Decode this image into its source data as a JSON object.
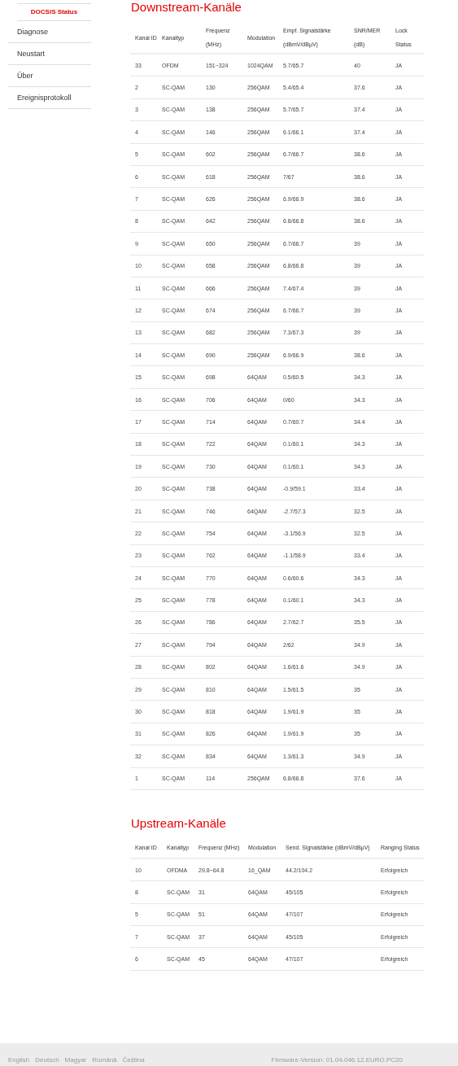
{
  "sidebar": {
    "items": [
      {
        "label": "DOCSIS Status",
        "selected": true
      },
      {
        "label": "Diagnose",
        "selected": false
      },
      {
        "label": "Neustart",
        "selected": false
      },
      {
        "label": "Über",
        "selected": false
      },
      {
        "label": "Ereignisprotokoll",
        "selected": false
      }
    ]
  },
  "downstream": {
    "title": "Downstream-Kanäle",
    "columns": [
      "Kanal ID",
      "Kanaltyp",
      "Frequenz (MHz)",
      "Modulation",
      "Empf. Signalstärke (dBmV/dBµV)",
      "SNR/MER (dB)",
      "Lock Status"
    ],
    "rows": [
      [
        "33",
        "OFDM",
        "151~324",
        "1024QAM",
        "5.7/65.7",
        "40",
        "JA"
      ],
      [
        "2",
        "SC-QAM",
        "130",
        "256QAM",
        "5.4/65.4",
        "37.6",
        "JA"
      ],
      [
        "3",
        "SC-QAM",
        "138",
        "256QAM",
        "5.7/65.7",
        "37.4",
        "JA"
      ],
      [
        "4",
        "SC-QAM",
        "146",
        "256QAM",
        "6.1/66.1",
        "37.4",
        "JA"
      ],
      [
        "5",
        "SC-QAM",
        "602",
        "256QAM",
        "6.7/66.7",
        "38.6",
        "JA"
      ],
      [
        "6",
        "SC-QAM",
        "618",
        "256QAM",
        "7/67",
        "38.6",
        "JA"
      ],
      [
        "7",
        "SC-QAM",
        "626",
        "256QAM",
        "6.9/66.9",
        "38.6",
        "JA"
      ],
      [
        "8",
        "SC-QAM",
        "642",
        "256QAM",
        "6.8/66.8",
        "38.6",
        "JA"
      ],
      [
        "9",
        "SC-QAM",
        "650",
        "256QAM",
        "6.7/66.7",
        "39",
        "JA"
      ],
      [
        "10",
        "SC-QAM",
        "658",
        "256QAM",
        "6.8/66.8",
        "39",
        "JA"
      ],
      [
        "11",
        "SC-QAM",
        "666",
        "256QAM",
        "7.4/67.4",
        "39",
        "JA"
      ],
      [
        "12",
        "SC-QAM",
        "674",
        "256QAM",
        "6.7/66.7",
        "39",
        "JA"
      ],
      [
        "13",
        "SC-QAM",
        "682",
        "256QAM",
        "7.3/67.3",
        "39",
        "JA"
      ],
      [
        "14",
        "SC-QAM",
        "690",
        "256QAM",
        "6.9/66.9",
        "38.6",
        "JA"
      ],
      [
        "15",
        "SC-QAM",
        "698",
        "64QAM",
        "0.5/60.5",
        "34.3",
        "JA"
      ],
      [
        "16",
        "SC-QAM",
        "706",
        "64QAM",
        "0/60",
        "34.3",
        "JA"
      ],
      [
        "17",
        "SC-QAM",
        "714",
        "64QAM",
        "0.7/60.7",
        "34.4",
        "JA"
      ],
      [
        "18",
        "SC-QAM",
        "722",
        "64QAM",
        "0.1/60.1",
        "34.3",
        "JA"
      ],
      [
        "19",
        "SC-QAM",
        "730",
        "64QAM",
        "0.1/60.1",
        "34.3",
        "JA"
      ],
      [
        "20",
        "SC-QAM",
        "738",
        "64QAM",
        "-0.9/59.1",
        "33.4",
        "JA"
      ],
      [
        "21",
        "SC-QAM",
        "746",
        "64QAM",
        "-2.7/57.3",
        "32.5",
        "JA"
      ],
      [
        "22",
        "SC-QAM",
        "754",
        "64QAM",
        "-3.1/56.9",
        "32.5",
        "JA"
      ],
      [
        "23",
        "SC-QAM",
        "762",
        "64QAM",
        "-1.1/58.9",
        "33.4",
        "JA"
      ],
      [
        "24",
        "SC-QAM",
        "770",
        "64QAM",
        "0.6/60.6",
        "34.3",
        "JA"
      ],
      [
        "25",
        "SC-QAM",
        "778",
        "64QAM",
        "0.1/60.1",
        "34.3",
        "JA"
      ],
      [
        "26",
        "SC-QAM",
        "786",
        "64QAM",
        "2.7/62.7",
        "35.5",
        "JA"
      ],
      [
        "27",
        "SC-QAM",
        "794",
        "64QAM",
        "2/62",
        "34.9",
        "JA"
      ],
      [
        "28",
        "SC-QAM",
        "802",
        "64QAM",
        "1.6/61.6",
        "34.9",
        "JA"
      ],
      [
        "29",
        "SC-QAM",
        "810",
        "64QAM",
        "1.5/61.5",
        "35",
        "JA"
      ],
      [
        "30",
        "SC-QAM",
        "818",
        "64QAM",
        "1.9/61.9",
        "35",
        "JA"
      ],
      [
        "31",
        "SC-QAM",
        "826",
        "64QAM",
        "1.9/61.9",
        "35",
        "JA"
      ],
      [
        "32",
        "SC-QAM",
        "834",
        "64QAM",
        "1.3/61.3",
        "34.9",
        "JA"
      ],
      [
        "1",
        "SC-QAM",
        "114",
        "256QAM",
        "6.8/66.8",
        "37.6",
        "JA"
      ]
    ]
  },
  "upstream": {
    "title": "Upstream-Kanäle",
    "columns": [
      "Kanal ID",
      "Kanaltyp",
      "Frequenz (MHz)",
      "Modulation",
      "Send. Signalstärke (dBmV/dBµV)",
      "Ranging Status"
    ],
    "rows": [
      [
        "10",
        "OFDMA",
        "29.8~64.8",
        "16_QAM",
        "44.2/104.2",
        "Erfolgreich"
      ],
      [
        "8",
        "SC-QAM",
        "31",
        "64QAM",
        "45/105",
        "Erfolgreich"
      ],
      [
        "5",
        "SC-QAM",
        "51",
        "64QAM",
        "47/107",
        "Erfolgreich"
      ],
      [
        "7",
        "SC-QAM",
        "37",
        "64QAM",
        "45/105",
        "Erfolgreich"
      ],
      [
        "6",
        "SC-QAM",
        "45",
        "64QAM",
        "47/107",
        "Erfolgreich"
      ]
    ]
  },
  "footer": {
    "languages": [
      "English",
      "Deutsch",
      "Magyar",
      "Română",
      "Čeština"
    ],
    "firmware": "Firmware-Version: 01.04.046.12.EURO.PC20"
  }
}
